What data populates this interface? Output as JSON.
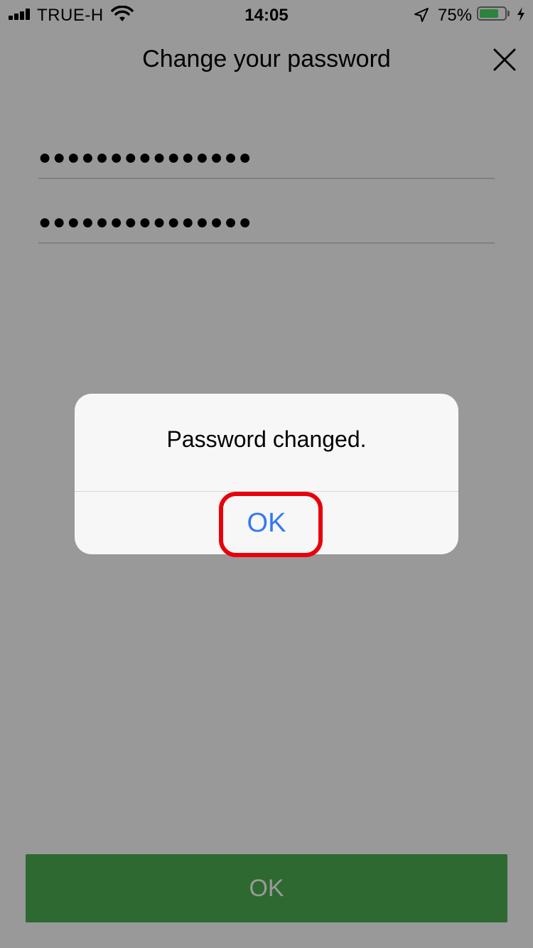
{
  "status_bar": {
    "carrier": "TRUE-H",
    "time": "14:05",
    "battery_percent": "75%",
    "battery_level": 0.75,
    "icons": [
      "signal-icon",
      "wifi-icon",
      "location-arrow-icon",
      "battery-icon",
      "charging-bolt-icon"
    ]
  },
  "header": {
    "title": "Change your password",
    "close_icon": "close-icon"
  },
  "form": {
    "new_password_value": "●●●●●●●●●●●●●●●",
    "confirm_password_value": "●●●●●●●●●●●●●●●"
  },
  "footer": {
    "ok_label": "OK"
  },
  "alert": {
    "message": "Password changed.",
    "ok_label": "OK",
    "ok_color": "#3478f6"
  },
  "colors": {
    "primary_green": "#4caf50",
    "highlight_red": "#e8000b",
    "battery_green": "#4cd964"
  }
}
